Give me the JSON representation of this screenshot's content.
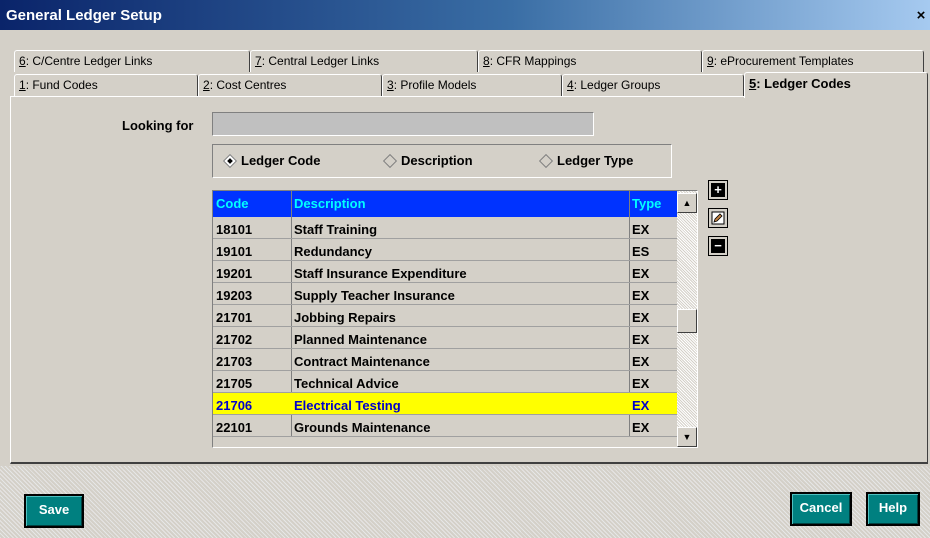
{
  "window": {
    "title": "General Ledger Setup",
    "close_glyph": "×"
  },
  "tabs_back": [
    {
      "key": "6",
      "label": ": C/Centre Ledger Links"
    },
    {
      "key": "7",
      "label": ": Central Ledger Links"
    },
    {
      "key": "8",
      "label": ": CFR Mappings"
    },
    {
      "key": "9",
      "label": ": eProcurement Templates"
    }
  ],
  "tabs_front": [
    {
      "key": "1",
      "label": ": Fund Codes"
    },
    {
      "key": "2",
      "label": ": Cost Centres"
    },
    {
      "key": "3",
      "label": ": Profile Models"
    },
    {
      "key": "4",
      "label": ": Ledger Groups"
    },
    {
      "key": "5",
      "label": ": Ledger Codes"
    }
  ],
  "search": {
    "label": "Looking for",
    "value": ""
  },
  "search_by": {
    "options": [
      "Ledger Code",
      "Description",
      "Ledger Type"
    ],
    "selected": "Ledger Code"
  },
  "grid": {
    "columns": [
      "Code",
      "Description",
      "Type"
    ],
    "rows": [
      {
        "code": "18101",
        "description": "Staff Training",
        "type": "EX"
      },
      {
        "code": "19101",
        "description": "Redundancy",
        "type": "ES"
      },
      {
        "code": "19201",
        "description": "Staff Insurance Expenditure",
        "type": "EX"
      },
      {
        "code": "19203",
        "description": "Supply Teacher Insurance",
        "type": "EX"
      },
      {
        "code": "21701",
        "description": "Jobbing Repairs",
        "type": "EX"
      },
      {
        "code": "21702",
        "description": "Planned Maintenance",
        "type": "EX"
      },
      {
        "code": "21703",
        "description": "Contract Maintenance",
        "type": "EX"
      },
      {
        "code": "21705",
        "description": "Technical Advice",
        "type": "EX"
      },
      {
        "code": "21706",
        "description": "Electrical Testing",
        "type": "EX"
      },
      {
        "code": "22101",
        "description": "Grounds Maintenance",
        "type": "EX"
      }
    ],
    "selected_code": "21706"
  },
  "side_buttons": {
    "add_icon": "plus-icon",
    "edit_icon": "pencil-icon",
    "delete_icon": "minus-icon"
  },
  "footer": {
    "save_label": "Save",
    "cancel_label": "Cancel",
    "help_label": "Help"
  },
  "colors": {
    "grid_header_bg": "#0033ff",
    "grid_header_text": "#00ffff",
    "selected_row": "#ffff00",
    "button_teal": "#008080"
  }
}
